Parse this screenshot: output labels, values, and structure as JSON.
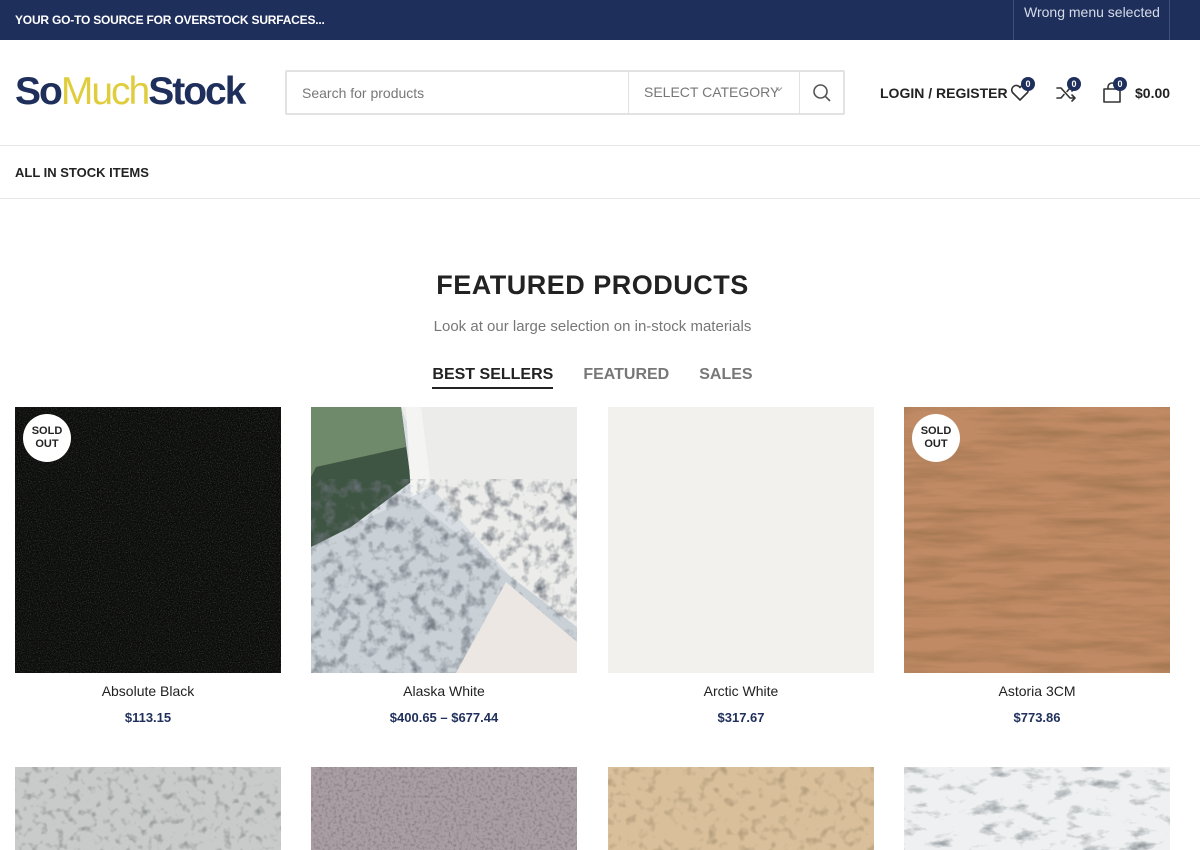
{
  "topbar": {
    "tagline": "YOUR GO-TO SOURCE FOR OVERSTOCK SURFACES...",
    "menu_notice": "Wrong menu selected"
  },
  "header": {
    "logo": {
      "part1": "So",
      "part2": "Much",
      "part3": "Stock"
    },
    "search": {
      "placeholder": "Search for products",
      "category_label": "SELECT CATEGORY"
    },
    "login_label": "LOGIN / REGISTER",
    "wishlist_count": "0",
    "compare_count": "0",
    "cart_count": "0",
    "cart_total": "$0.00"
  },
  "nav": {
    "items": [
      {
        "label": "ALL IN STOCK ITEMS"
      }
    ]
  },
  "section": {
    "title": "FEATURED PRODUCTS",
    "subtitle": "Look at our large selection on in-stock materials",
    "tabs": [
      {
        "label": "BEST SELLERS",
        "active": true
      },
      {
        "label": "FEATURED",
        "active": false
      },
      {
        "label": "SALES",
        "active": false
      }
    ]
  },
  "products": [
    {
      "name": "Absolute Black",
      "price": "$113.15",
      "sold_out": true,
      "sold_label_1": "SOLD",
      "sold_label_2": "OUT"
    },
    {
      "name": "Alaska White",
      "price": "$400.65 – $677.44",
      "sold_out": false
    },
    {
      "name": "Arctic White",
      "price": "$317.67",
      "sold_out": false
    },
    {
      "name": "Astoria 3CM",
      "price": "$773.86",
      "sold_out": true,
      "sold_label_1": "SOLD",
      "sold_label_2": "OUT"
    }
  ],
  "colors": {
    "brand_navy": "#1f2f5c",
    "brand_yellow": "#e0cd3e"
  }
}
